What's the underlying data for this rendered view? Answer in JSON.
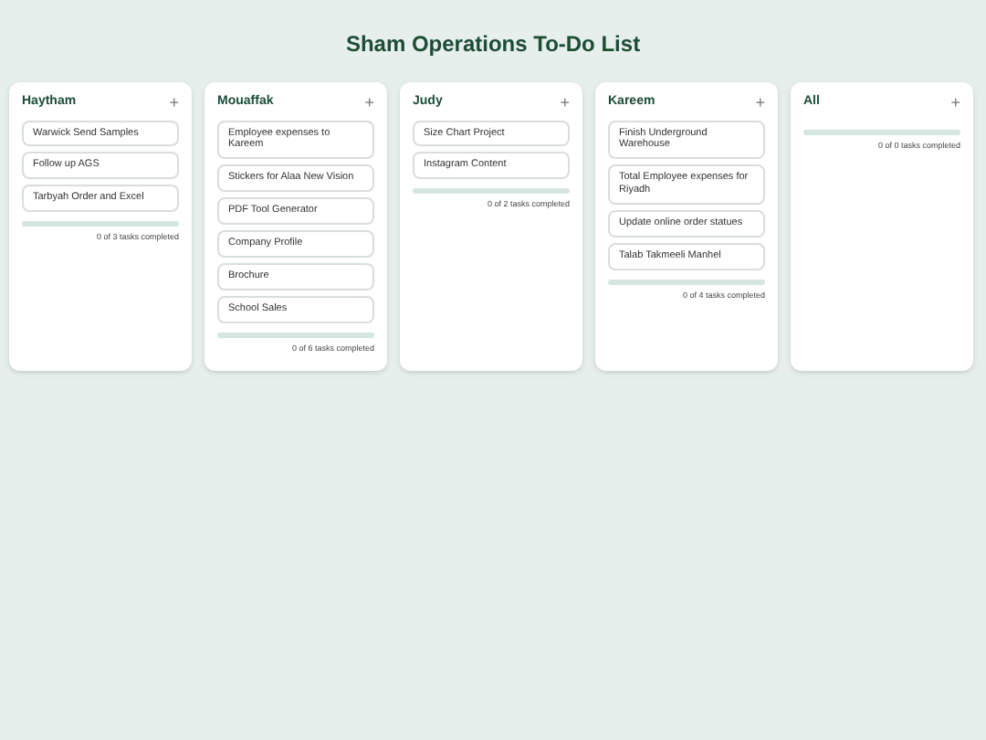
{
  "title": "Sham Operations To-Do List",
  "columns": [
    {
      "name": "Haytham",
      "add_icon": "+",
      "tasks": [
        "Warwick Send Samples",
        "Follow up AGS",
        "Tarbyah Order and Excel"
      ],
      "level": 0,
      "summary": "0 of 3 tasks completed"
    },
    {
      "name": "Mouaffak",
      "add_icon": "+",
      "tasks": [
        "Employee expenses to Kareem",
        "Stickers for Alaa New Vision",
        "PDF Tool Generator",
        "Company Profile",
        "Brochure",
        "School Sales"
      ],
      "level": 0,
      "summary": "0 of 6 tasks completed"
    },
    {
      "name": "Judy",
      "add_icon": "+",
      "tasks": [
        "Size Chart Project",
        "Instagram Content"
      ],
      "level": 0,
      "summary": "0 of 2 tasks completed"
    },
    {
      "name": "Kareem",
      "add_icon": "+",
      "tasks": [
        "Finish Underground Warehouse",
        "Total Employee expenses for Riyadh",
        "Update online order statues",
        "Talab Takmeeli Manhel"
      ],
      "level": 0,
      "summary": "0 of 4 tasks completed"
    },
    {
      "name": "All",
      "add_icon": "+",
      "level": 0,
      "summary": "0 of 0 tasks completed"
    }
  ]
}
